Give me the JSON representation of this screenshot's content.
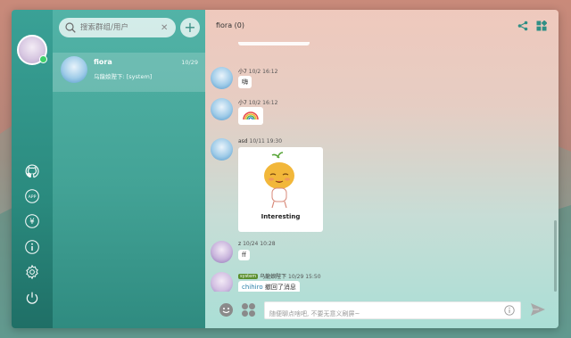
{
  "sidebar": {
    "icons": [
      "github-icon",
      "app-icon",
      "yen-icon",
      "info-icon",
      "settings-icon",
      "power-icon"
    ],
    "app_label": "APP",
    "yen_label": "¥"
  },
  "chatlist": {
    "search_placeholder": "搜索群组/用户",
    "add_label": "+",
    "conversations": [
      {
        "name": "fiora",
        "time": "10/29",
        "preview": "乌龍娘陛下: [system]"
      }
    ]
  },
  "chat": {
    "title": "fiora (0)",
    "messages": [
      {
        "user": "小7",
        "time": "10/2 16:12",
        "text": "嗨"
      },
      {
        "user": "小7",
        "time": "10/2 16:12",
        "content": "rainbow-emoji"
      },
      {
        "user": "asd",
        "time": "10/11 19:30",
        "sticker_caption": "Interesting"
      },
      {
        "user": "z",
        "time": "10/24 10:28",
        "text": "ff"
      },
      {
        "user": "乌龍娘陛下",
        "badge": "system",
        "time": "10/29 15:50",
        "user_strong": "chihiro",
        "text": "撤回了消息"
      }
    ],
    "input_placeholder": "随便聊点啥吧, 不要无意义刷屏~"
  },
  "colors": {
    "accent": "#3aa196",
    "online": "#3ecf6a",
    "system_badge": "#5a8f2d"
  }
}
